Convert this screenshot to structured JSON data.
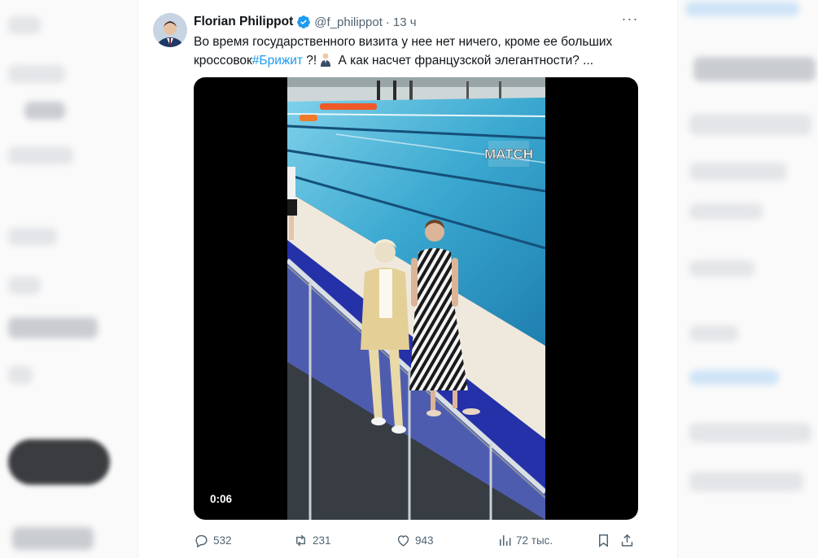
{
  "tweet": {
    "display_name": "Florian Philippot",
    "handle": "@f_philippot",
    "separator": "·",
    "time": "13 ч",
    "more_label": "···",
    "text_part1": "Во время государственного визита у нее нет ничего, кроме ее больших кроссовок",
    "hashtag": "#Брижит",
    "text_part2": " ?!",
    "text_part3": " А как насчет французской элегантности? ...",
    "media": {
      "watermark": "MATCH",
      "duration": "0:06"
    },
    "actions": {
      "replies": "532",
      "reposts": "231",
      "likes": "943",
      "views": "72 тыс."
    },
    "icons": [
      "verified-icon",
      "more-icon",
      "reply-icon",
      "repost-icon",
      "like-icon",
      "views-icon",
      "bookmark-icon",
      "share-icon"
    ],
    "colors": {
      "accent": "#1d9bf0",
      "secondary_text": "#536471"
    }
  }
}
